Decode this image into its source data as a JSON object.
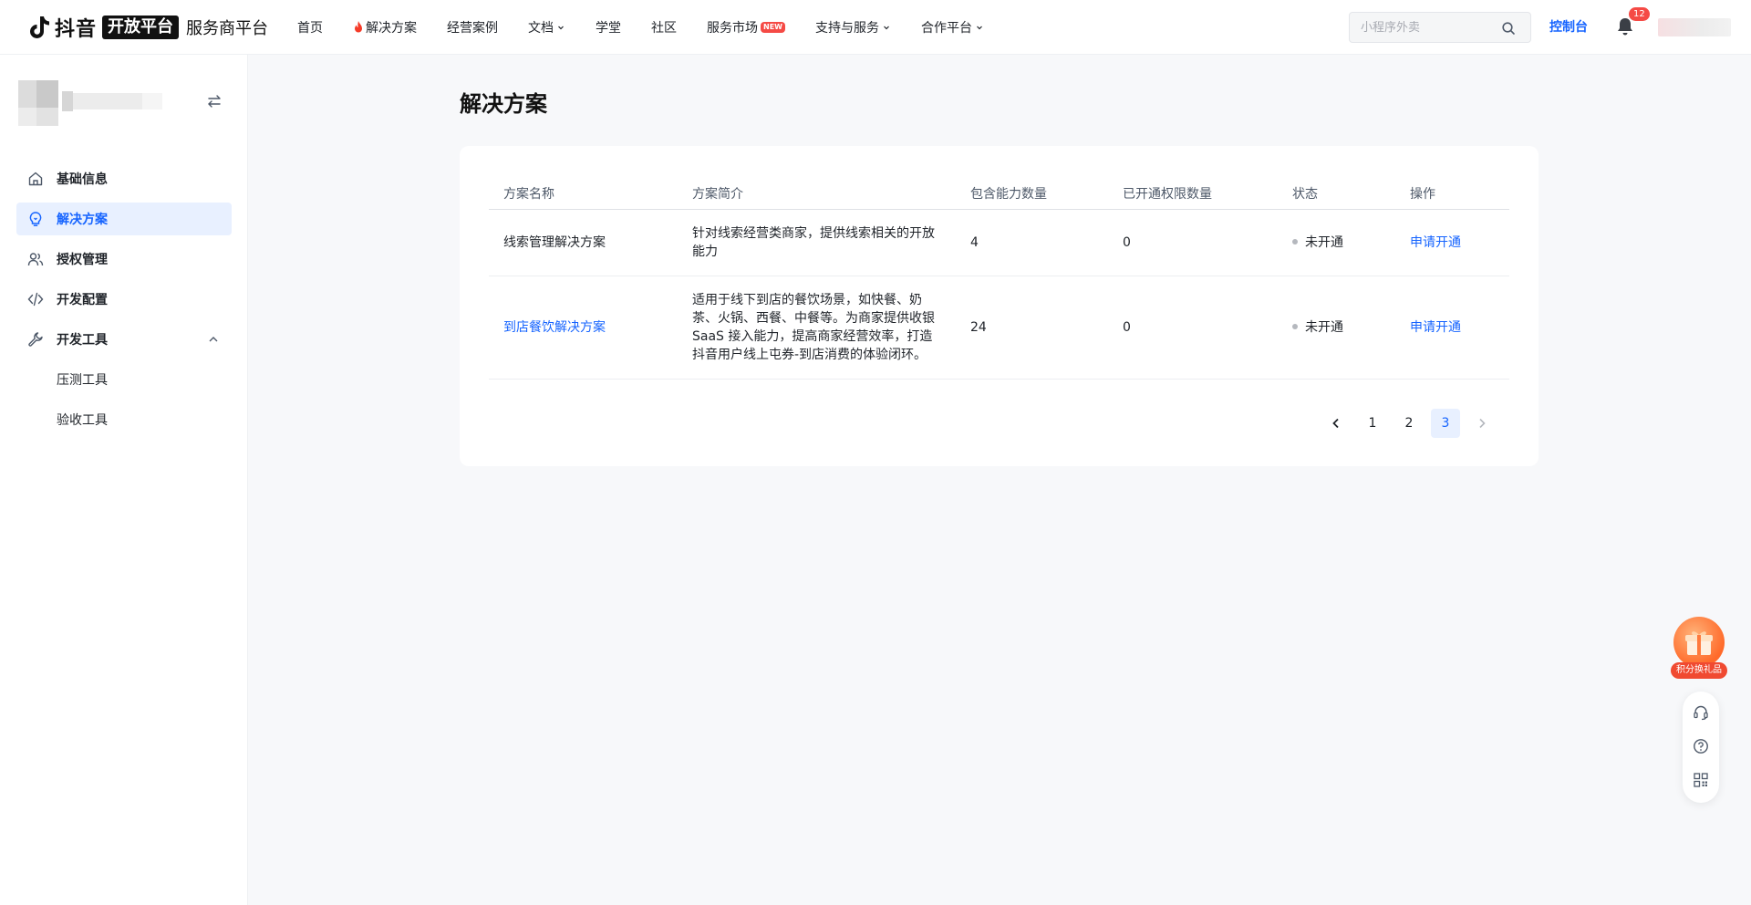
{
  "topbar": {
    "logo": {
      "brand": "抖音",
      "open": "开放平台",
      "sub": "服务商平台"
    },
    "nav": [
      {
        "label": "首页",
        "icon": "",
        "dropdown": false,
        "badge": ""
      },
      {
        "label": "解决方案",
        "icon": "flame-icon",
        "dropdown": false,
        "badge": ""
      },
      {
        "label": "经营案例",
        "icon": "",
        "dropdown": false,
        "badge": ""
      },
      {
        "label": "文档",
        "icon": "",
        "dropdown": true,
        "badge": ""
      },
      {
        "label": "学堂",
        "icon": "",
        "dropdown": false,
        "badge": ""
      },
      {
        "label": "社区",
        "icon": "",
        "dropdown": false,
        "badge": ""
      },
      {
        "label": "服务市场",
        "icon": "",
        "dropdown": false,
        "badge": "NEW"
      },
      {
        "label": "支持与服务",
        "icon": "",
        "dropdown": true,
        "badge": ""
      },
      {
        "label": "合作平台",
        "icon": "",
        "dropdown": true,
        "badge": ""
      }
    ],
    "search": {
      "placeholder": "小程序外卖",
      "value": ""
    },
    "console_label": "控制台",
    "notification_count": "12",
    "accent_color": "#1664ff"
  },
  "sidebar": {
    "items": [
      {
        "label": "基础信息",
        "icon": "home-icon",
        "active": false
      },
      {
        "label": "解决方案",
        "icon": "bulb-icon",
        "active": true
      },
      {
        "label": "授权管理",
        "icon": "users-icon",
        "active": false
      },
      {
        "label": "开发配置",
        "icon": "code-icon",
        "active": false
      },
      {
        "label": "开发工具",
        "icon": "wrench-icon",
        "active": false,
        "expanded": true
      },
      {
        "label": "压测工具",
        "sub": true
      },
      {
        "label": "验收工具",
        "sub": true
      }
    ]
  },
  "main": {
    "title": "解决方案",
    "table": {
      "columns": [
        "方案名称",
        "方案简介",
        "包含能力数量",
        "已开通权限数量",
        "状态",
        "操作"
      ],
      "rows": [
        {
          "name": "线索管理解决方案",
          "name_is_link": false,
          "intro": "针对线索经营类商家，提供线索相关的开放能力",
          "ability_count": "4",
          "opened_count": "0",
          "status": "未开通",
          "action": "申请开通"
        },
        {
          "name": "到店餐饮解决方案",
          "name_is_link": true,
          "intro": "适用于线下到店的餐饮场景，如快餐、奶茶、火锅、西餐、中餐等。为商家提供收银SaaS 接入能力，提高商家经营效率，打造抖音用户线上屯券-到店消费的体验闭环。",
          "ability_count": "24",
          "opened_count": "0",
          "status": "未开通",
          "action": "申请开通"
        }
      ]
    },
    "pagination": {
      "pages": [
        "1",
        "2",
        "3"
      ],
      "current": "3"
    }
  },
  "widgets": {
    "gift_label": "积分换礼品",
    "tools": [
      "headset-icon",
      "help-icon",
      "qrcode-icon"
    ]
  }
}
